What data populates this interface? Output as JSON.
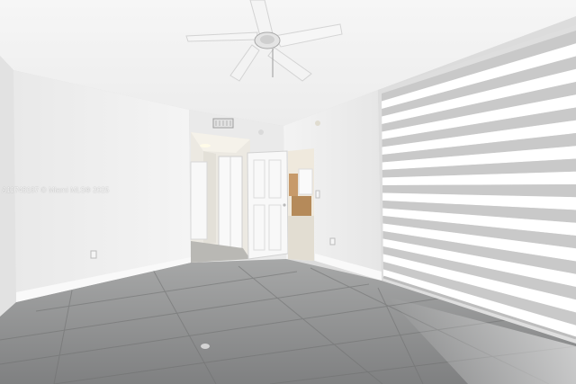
{
  "photo": {
    "subject": "empty-room-interior",
    "watermark": "A11743187 © Miami MLS® 2025",
    "colors": {
      "ceiling": "#efefef",
      "left_wall": "#f2f2f2",
      "back_wall": "#e9e9e9",
      "right_wall": "#f4f4f4",
      "floor": "#8f9090",
      "floor_grout": "#7a7b7b",
      "blind_dark": "#c9c9c9",
      "blind_light": "#ffffff",
      "door": "#f7f7f7",
      "hallway": "#ece7da",
      "far_room": "#d8c3a0"
    }
  }
}
